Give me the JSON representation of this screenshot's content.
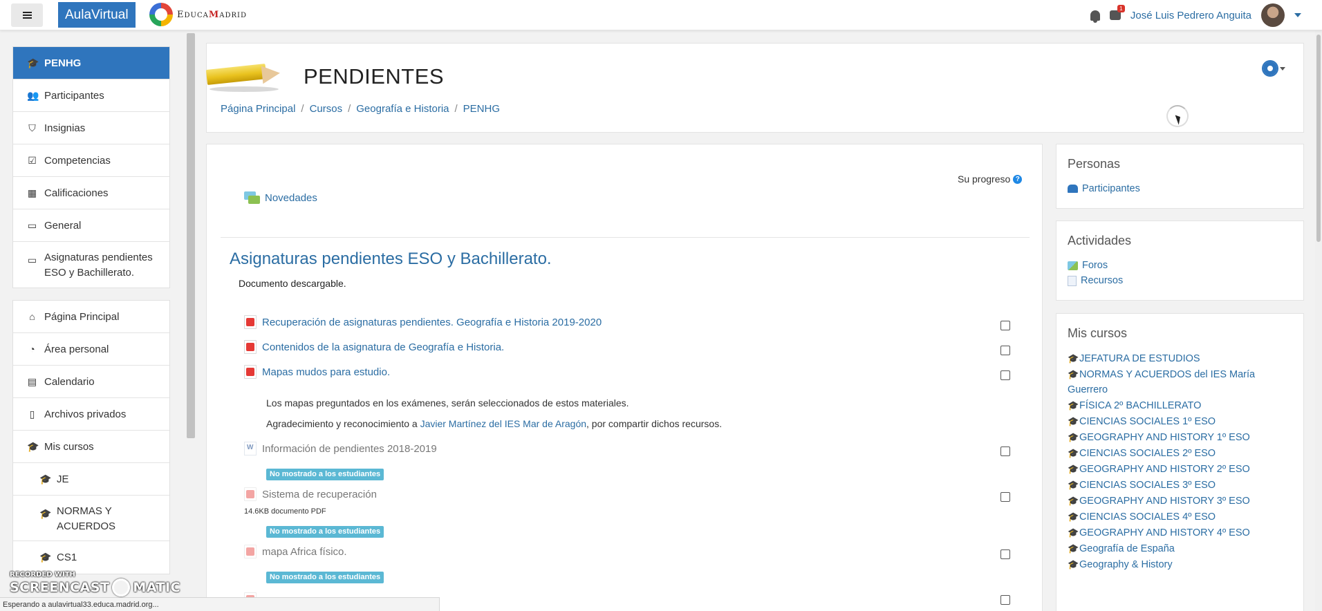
{
  "navbar": {
    "brand": "AulaVirtual",
    "logo_text_prefix": "E",
    "logo_text_rest": "DUCA",
    "logo_text_m": "M",
    "logo_text_end": "ADRID",
    "notification_count": "1",
    "user_name": "José Luis Pedrero Anguita"
  },
  "sidebar": {
    "course_items": [
      {
        "label": "PENHG",
        "icon": "graduation-cap-icon"
      },
      {
        "label": "Participantes",
        "icon": "users-icon"
      },
      {
        "label": "Insignias",
        "icon": "shield-icon"
      },
      {
        "label": "Competencias",
        "icon": "check-square-icon"
      },
      {
        "label": "Calificaciones",
        "icon": "table-icon"
      },
      {
        "label": "General",
        "icon": "folder-icon"
      },
      {
        "label": "Asignaturas pendientes ESO y Bachillerato.",
        "icon": "folder-icon"
      }
    ],
    "site_items": [
      {
        "label": "Página Principal",
        "icon": "home-icon"
      },
      {
        "label": "Área personal",
        "icon": "dashboard-icon"
      },
      {
        "label": "Calendario",
        "icon": "calendar-icon"
      },
      {
        "label": "Archivos privados",
        "icon": "file-icon"
      },
      {
        "label": "Mis cursos",
        "icon": "graduation-cap-icon"
      },
      {
        "label": "JE",
        "icon": "graduation-cap-icon"
      },
      {
        "label": "NORMAS Y ACUERDOS",
        "icon": "graduation-cap-icon"
      },
      {
        "label": "CS1",
        "icon": "graduation-cap-icon"
      }
    ]
  },
  "header": {
    "title": "PENDIENTES",
    "breadcrumb": [
      "Página Principal",
      "Cursos",
      "Geografía e Historia",
      "PENHG"
    ],
    "separator": "/"
  },
  "content": {
    "progress_label": "Su progreso",
    "news_label": "Novedades",
    "section_title": "Asignaturas pendientes ESO y Bachillerato.",
    "section_summary": "Documento descargable.",
    "activities": [
      "Recuperación de asignaturas pendientes. Geografía e Historia 2019-2020",
      "Contenidos de la asignatura de Geografía e Historia.",
      "Mapas mudos para estudio.",
      "Información de pendientes 2018-2019",
      "Sistema de recuperación",
      "mapa Africa físico."
    ],
    "maps_note": "Los mapas preguntados en los exámenes, serán seleccionados de estos materiales.",
    "thanks_prefix": "Agradecimiento y reconocimiento a",
    "thanks_link": "Javier Martínez del IES Mar de Aragón",
    "thanks_suffix": ", por compartir dichos recursos.",
    "hidden_badge": "No mostrado a los estudiantes",
    "resource_meta": "14.6KB documento PDF"
  },
  "blocks": {
    "people_title": "Personas",
    "people_link": "Participantes",
    "activities_title": "Actividades",
    "activities_links": [
      "Foros",
      "Recursos"
    ],
    "courses_title": "Mis cursos",
    "courses": [
      "JEFATURA DE ESTUDIOS",
      "NORMAS Y ACUERDOS del IES María Guerrero",
      "FÍSICA 2º BACHILLERATO",
      "CIENCIAS SOCIALES 1º ESO",
      "GEOGRAPHY AND HISTORY 1º ESO",
      "CIENCIAS SOCIALES 2º ESO",
      "GEOGRAPHY AND HISTORY 2º ESO",
      "CIENCIAS SOCIALES 3º ESO",
      "GEOGRAPHY AND HISTORY 3º ESO",
      "CIENCIAS SOCIALES 4º ESO",
      "GEOGRAPHY AND HISTORY 4º ESO",
      "Geografía de España",
      "Geography & History"
    ]
  },
  "status_bar": "Esperando a aulavirtual33.educa.madrid.org...",
  "watermark": {
    "top": "RECORDED WITH",
    "left": "SCREENCAST",
    "right": "MATIC"
  },
  "colors": {
    "accent": "#2f75bd",
    "link": "#2b6da3",
    "badge": "#5bb8d4"
  }
}
